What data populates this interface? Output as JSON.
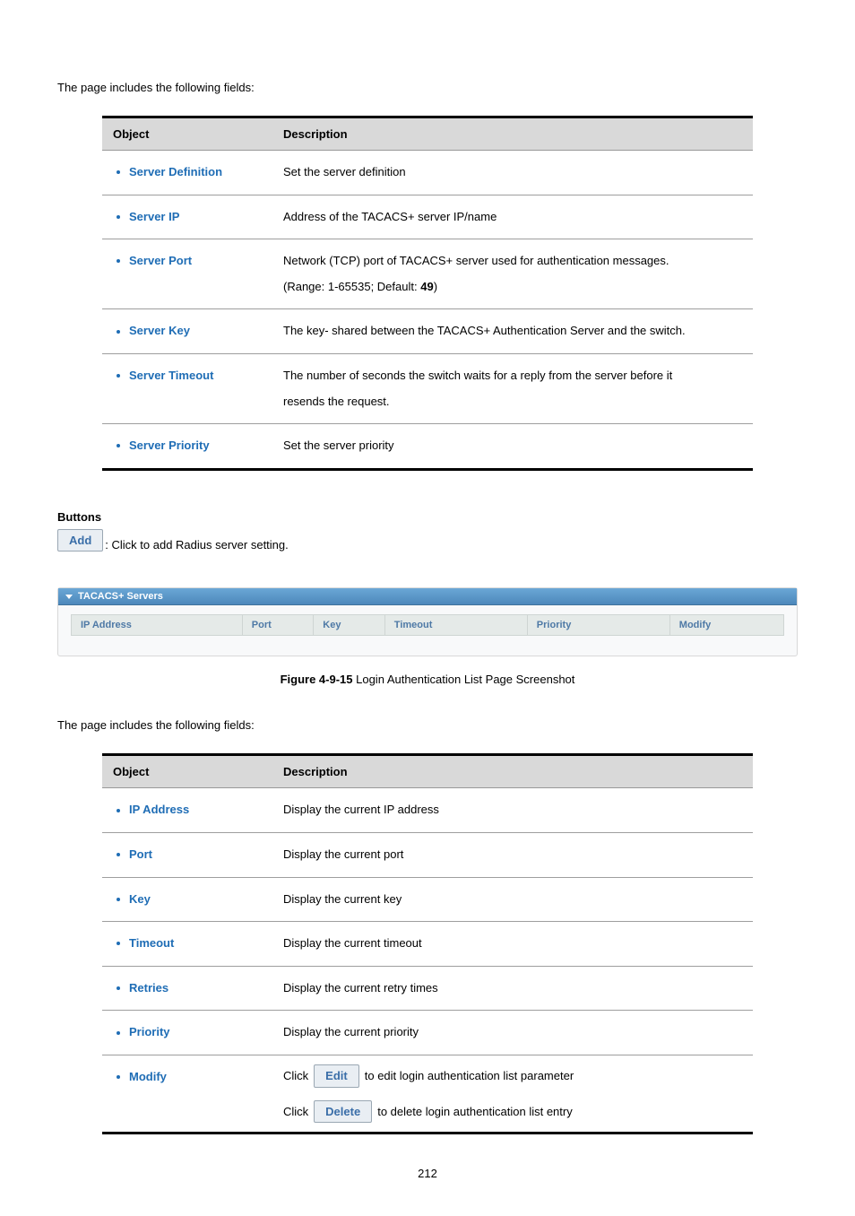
{
  "intro1": "The page includes the following fields:",
  "table1": {
    "head_object": "Object",
    "head_description": "Description",
    "rows": {
      "r0": {
        "name": "Server Definition",
        "desc": "Set the server definition"
      },
      "r1": {
        "name": "Server IP",
        "desc": "Address of the TACACS+ server IP/name"
      },
      "r2": {
        "name": "Server Port",
        "desc_a": "Network (TCP) port of TACACS+ server used for authentication messages.",
        "desc_b_prefix": "(Range: 1-65535; Default: ",
        "desc_b_bold": "49",
        "desc_b_suffix": ")"
      },
      "r3": {
        "name": "Server Key",
        "desc": "The key- shared between the TACACS+ Authentication Server and the switch."
      },
      "r4": {
        "name": "Server Timeout",
        "desc_a": "The number of seconds the switch waits for a reply from the server before it",
        "desc_b": "resends the request."
      },
      "r5": {
        "name": "Server Priority",
        "desc": "Set the server priority"
      }
    }
  },
  "buttons_heading": "Buttons",
  "btn_add": "Add",
  "btn_add_desc": ": Click to add Radius server setting.",
  "screenshot": {
    "panel_title": "TACACS+ Servers",
    "cols": {
      "c0": "IP Address",
      "c1": "Port",
      "c2": "Key",
      "c3": "Timeout",
      "c4": "Priority",
      "c5": "Modify"
    }
  },
  "figure": {
    "label": "Figure 4-9-15",
    "text": " Login Authentication List Page Screenshot"
  },
  "intro2": "The page includes the following fields:",
  "table2": {
    "head_object": "Object",
    "head_description": "Description",
    "rows": {
      "r0": {
        "name": "IP Address",
        "desc": "Display the current IP address"
      },
      "r1": {
        "name": "Port",
        "desc": "Display the current port"
      },
      "r2": {
        "name": "Key",
        "desc": "Display the current key"
      },
      "r3": {
        "name": "Timeout",
        "desc": "Display the current timeout"
      },
      "r4": {
        "name": "Retries",
        "desc": "Display the current retry times"
      },
      "r5": {
        "name": "Priority",
        "desc": "Display the current priority"
      },
      "r6": {
        "name": "Modify",
        "click": "Click",
        "btn_edit": "Edit",
        "edit_desc": " to edit login authentication list parameter",
        "btn_delete": "Delete",
        "delete_desc": " to delete login authentication list entry"
      }
    }
  },
  "page_number": "212"
}
